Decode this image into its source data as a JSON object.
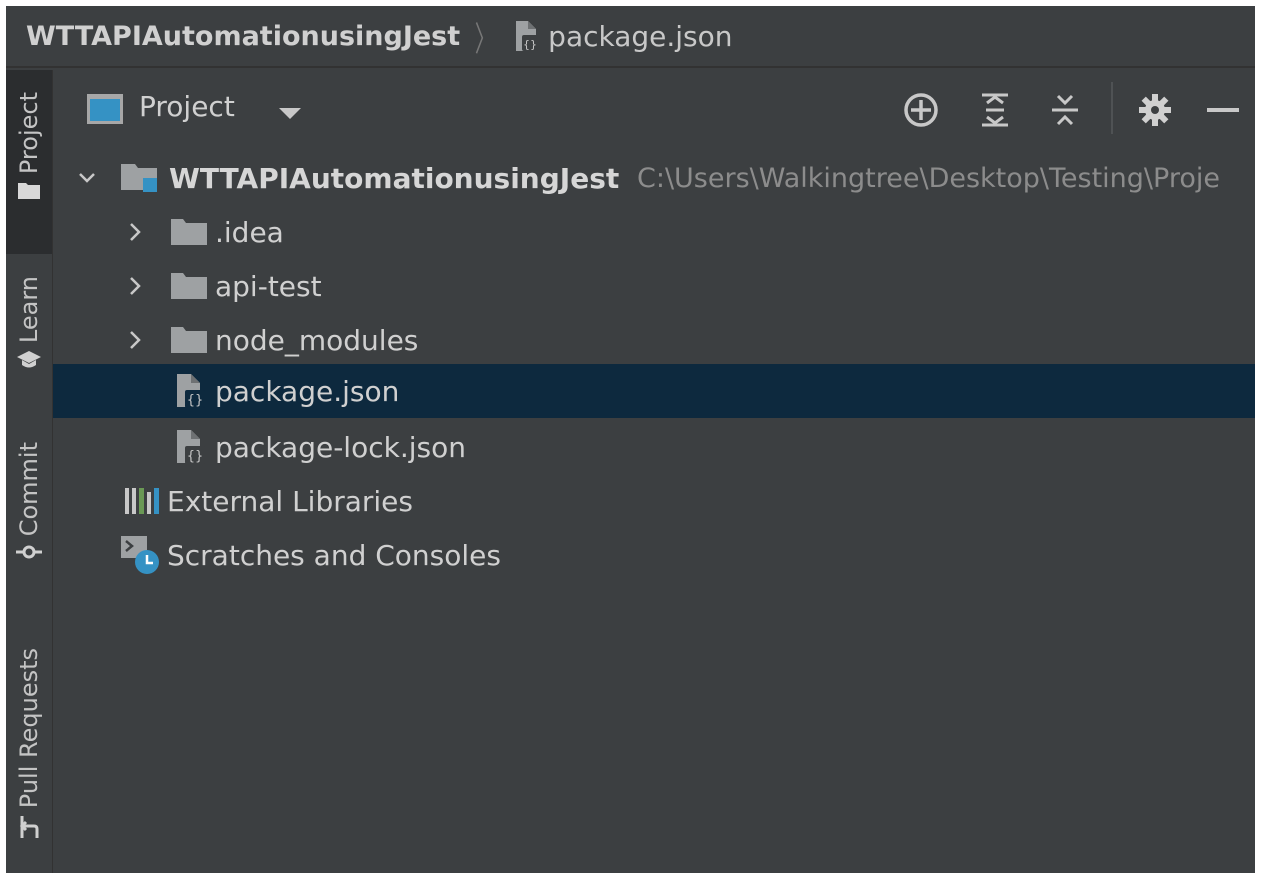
{
  "navbar": {
    "project": "WTTAPIAutomationusingJest",
    "separator": "〉",
    "file": "package.json"
  },
  "toolstrip": {
    "project": "Project",
    "learn": "Learn",
    "commit": "Commit",
    "pull_requests": "Pull Requests"
  },
  "panel": {
    "view_label": "Project",
    "icons": [
      "locate-icon",
      "expand-all-icon",
      "collapse-all-icon",
      "gear-icon",
      "minimize-icon"
    ]
  },
  "tree": {
    "root": {
      "label": "WTTAPIAutomationusingJest",
      "path": "C:\\Users\\Walkingtree\\Desktop\\Testing\\Proje"
    },
    "items": [
      {
        "label": ".idea",
        "type": "folder"
      },
      {
        "label": "api-test",
        "type": "folder"
      },
      {
        "label": "node_modules",
        "type": "folder"
      },
      {
        "label": "package.json",
        "type": "json-file",
        "selected": true
      },
      {
        "label": "package-lock.json",
        "type": "json-file"
      }
    ],
    "external_libraries": "External Libraries",
    "scratches": "Scratches and Consoles"
  },
  "colors": {
    "background": "#3c3f41",
    "selection": "#0d293e",
    "accent": "#3592c4",
    "text": "#d0d0d0",
    "path_text": "#8c8c8c"
  }
}
